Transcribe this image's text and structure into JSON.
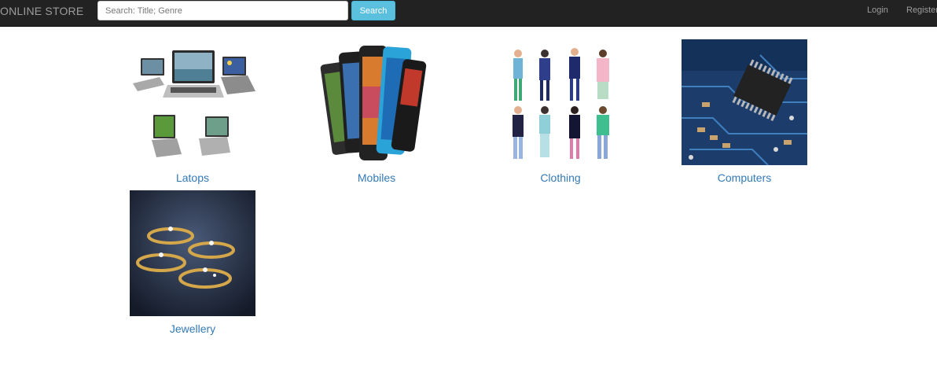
{
  "navbar": {
    "brand": "ONLINE STORE",
    "search": {
      "placeholder": "Search: Title; Genre",
      "value": "",
      "button_label": "Search"
    },
    "links": {
      "login": "Login",
      "register": "Register"
    }
  },
  "categories": [
    {
      "label": "Latops",
      "image": "laptops-image"
    },
    {
      "label": "Mobiles",
      "image": "mobiles-image"
    },
    {
      "label": "Clothing",
      "image": "clothing-image"
    },
    {
      "label": "Computers",
      "image": "computers-image"
    },
    {
      "label": "Jewellery",
      "image": "jewellery-image"
    }
  ],
  "colors": {
    "navbar_bg": "#222222",
    "brand_text": "#9d9d9d",
    "search_button": "#5bc0de",
    "link": "#337ab7"
  }
}
